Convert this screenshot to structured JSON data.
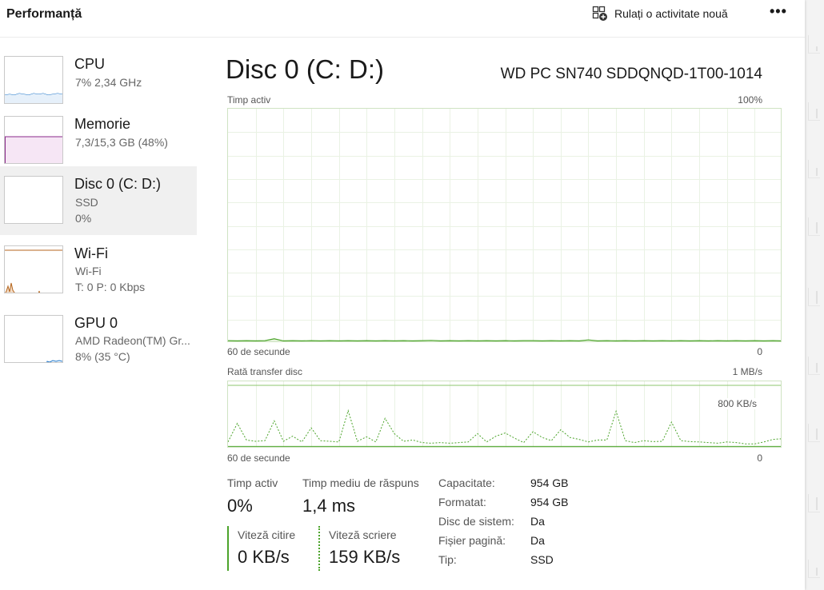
{
  "header": {
    "title": "Performanță",
    "run_task_label": "Rulați o activitate nouă",
    "more_label": "•••"
  },
  "sidebar": {
    "items": [
      {
        "name": "CPU",
        "line1": "7%  2,34 GHz",
        "line2": ""
      },
      {
        "name": "Memorie",
        "line1": "7,3/15,3 GB (48%)",
        "line2": ""
      },
      {
        "name": "Disc 0 (C: D:)",
        "line1": "SSD",
        "line2": "0%"
      },
      {
        "name": "Wi-Fi",
        "line1": "Wi-Fi",
        "line2": "T: 0 P: 0 Kbps"
      },
      {
        "name": "GPU 0",
        "line1": "AMD Radeon(TM) Gr...",
        "line2": "8%  (35 °C)"
      }
    ]
  },
  "main": {
    "title": "Disc 0 (C: D:)",
    "model": "WD PC SN740 SDDQNQD-1T00-1014",
    "active_graph": {
      "label": "Timp activ",
      "max_label": "100%",
      "time_label": "60 de secunde",
      "min_label": "0"
    },
    "transfer_graph": {
      "label": "Rată transfer disc",
      "max_label": "1 MB/s",
      "mid_label": "800 KB/s",
      "time_label": "60 de secunde",
      "min_label": "0"
    },
    "stats": {
      "active_time_label": "Timp activ",
      "active_time_value": "0%",
      "response_label": "Timp mediu de răspuns",
      "response_value": "1,4 ms",
      "read_label": "Viteză citire",
      "read_value": "0 KB/s",
      "write_label": "Viteză scriere",
      "write_value": "159 KB/s"
    },
    "properties": [
      {
        "label": "Capacitate:",
        "value": "954 GB"
      },
      {
        "label": "Formatat:",
        "value": "954 GB"
      },
      {
        "label": "Disc de sistem:",
        "value": "Da"
      },
      {
        "label": "Fișier pagină:",
        "value": "Da"
      },
      {
        "label": "Tip:",
        "value": "SSD"
      }
    ]
  },
  "colors": {
    "disk_green": "#4ca42b",
    "cpu_blue": "#1a73c7",
    "memory_purple": "#8b2a8b",
    "wifi_orange": "#b5651d"
  },
  "chart_data": [
    {
      "type": "line",
      "title": "Timp activ",
      "ylim": [
        0,
        100
      ],
      "x": [
        0,
        1,
        2,
        3,
        4,
        5,
        6,
        7,
        8,
        9,
        10,
        11,
        12,
        13,
        14,
        15,
        16,
        17,
        18,
        19,
        20,
        21,
        22,
        23,
        24,
        25,
        26,
        27,
        28,
        29,
        30,
        31,
        32,
        33,
        34,
        35,
        36,
        37,
        38,
        39,
        40,
        41,
        42,
        43,
        44,
        45,
        46,
        47,
        48,
        49,
        50,
        51,
        52,
        53,
        54,
        55,
        56,
        57,
        58,
        59,
        60
      ],
      "values": [
        0.3,
        0.2,
        0.3,
        0.2,
        0.3,
        1.1,
        0.2,
        0.3,
        0.2,
        0.3,
        0.2,
        0.3,
        0.2,
        0.3,
        0.2,
        0.3,
        0.2,
        0.3,
        0.2,
        0.3,
        0.2,
        0.3,
        0.4,
        0.2,
        0.3,
        0.2,
        0.3,
        0.2,
        0.3,
        0.2,
        0.3,
        0.2,
        0.3,
        0.3,
        0.2,
        0.3,
        0.2,
        0.3,
        0.2,
        0.6,
        0.2,
        0.3,
        0.2,
        0.3,
        0.2,
        0.3,
        0.2,
        0.3,
        0.2,
        0.3,
        0.2,
        0.3,
        0.2,
        0.3,
        0.2,
        0.3,
        0.2,
        0.3,
        0.2,
        0.3,
        0.2
      ]
    },
    {
      "type": "line",
      "title": "Rată transfer disc",
      "ylim": [
        0,
        1000
      ],
      "series": [
        {
          "name": "Viteză citire",
          "values": [
            20,
            20,
            20,
            20,
            20,
            20,
            20,
            20,
            20,
            20,
            20,
            20,
            20,
            20,
            20,
            20,
            20,
            20,
            20,
            20,
            20,
            20,
            20,
            20,
            20,
            20,
            20,
            20,
            20,
            20,
            20,
            20,
            20,
            20,
            20,
            20,
            20,
            20,
            20,
            20,
            20,
            20,
            20,
            20,
            20,
            20,
            20,
            20,
            20,
            20,
            20,
            20,
            20,
            20,
            20,
            20,
            20,
            20,
            20,
            20,
            20
          ]
        },
        {
          "name": "Viteză scriere",
          "values": [
            90,
            380,
            120,
            100,
            110,
            420,
            100,
            180,
            90,
            310,
            110,
            100,
            90,
            580,
            100,
            170,
            90,
            460,
            220,
            100,
            120,
            80,
            70,
            80,
            70,
            80,
            90,
            220,
            90,
            180,
            230,
            150,
            80,
            250,
            160,
            110,
            280,
            160,
            130,
            90,
            120,
            120,
            570,
            110,
            80,
            110,
            95,
            100,
            400,
            110,
            95,
            90,
            80,
            70,
            90,
            80,
            60,
            60,
            90,
            130,
            140
          ]
        }
      ]
    }
  ]
}
